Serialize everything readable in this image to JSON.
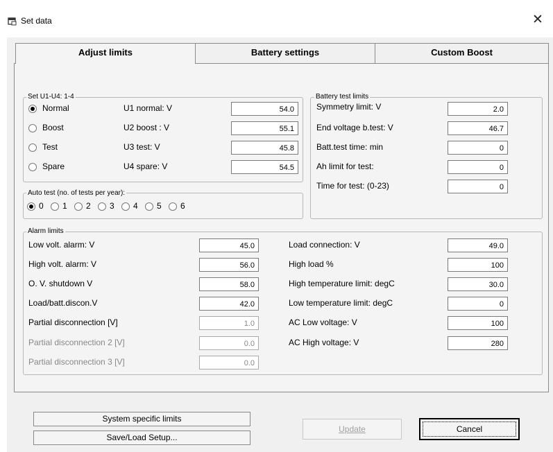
{
  "window": {
    "title": "Set data",
    "close_glyph": "✕"
  },
  "tabs": [
    "Adjust limits",
    "Battery settings",
    "Custom Boost"
  ],
  "set_u": {
    "legend": "Set U1-U4: 1-4",
    "rows": [
      {
        "radio": "Normal",
        "label": "U1 normal:  V",
        "value": "54.0",
        "checked": true
      },
      {
        "radio": "Boost",
        "label": "U2 boost :  V",
        "value": "55.1",
        "checked": false
      },
      {
        "radio": "Test",
        "label": "U3 test:   V",
        "value": "45.8",
        "checked": false
      },
      {
        "radio": "Spare",
        "label": "U4 spare:   V",
        "value": "54.5",
        "checked": false
      }
    ]
  },
  "auto_test": {
    "legend": "Auto test (no. of tests per year):",
    "options": [
      "0",
      "1",
      "2",
      "3",
      "4",
      "5",
      "6"
    ],
    "selected": "0"
  },
  "battery_test": {
    "legend": "Battery test limits",
    "rows": [
      {
        "label": "Symmetry limit: V",
        "value": "2.0"
      },
      {
        "label": "End voltage b.test: V",
        "value": "46.7"
      },
      {
        "label": "Batt.test time: min",
        "value": "0"
      },
      {
        "label": "Ah limit for test:",
        "value": "0"
      },
      {
        "label": "Time for test: (0-23)",
        "value": "0"
      }
    ]
  },
  "alarm_limits": {
    "legend": "Alarm limits",
    "left": [
      {
        "label": "Low volt. alarm: V",
        "value": "45.0",
        "disabled": false
      },
      {
        "label": "High volt. alarm: V",
        "value": "56.0",
        "disabled": false
      },
      {
        "label": "O. V. shutdown V",
        "value": "58.0",
        "disabled": false
      },
      {
        "label": "Load/batt.discon.V",
        "value": "42.0",
        "disabled": false
      },
      {
        "label": "Partial disconnection   [V]",
        "value": "1.0",
        "disabled": false
      },
      {
        "label": "Partial disconnection 2 [V]",
        "value": "0.0",
        "disabled": true
      },
      {
        "label": "Partial disconnection 3 [V]",
        "value": "0.0",
        "disabled": true
      }
    ],
    "right": [
      {
        "label": "Load connection: V",
        "value": "49.0"
      },
      {
        "label": "High load %",
        "value": "100"
      },
      {
        "label": "High temperature limit: degC",
        "value": "30.0"
      },
      {
        "label": "Low temperature limit: degC",
        "value": "0"
      },
      {
        "label": "AC Low voltage: V",
        "value": "100"
      },
      {
        "label": "AC High voltage: V",
        "value": "280"
      }
    ]
  },
  "buttons": {
    "system_limits": "System specific limits",
    "save_load": "Save/Load Setup...",
    "update": "Update",
    "cancel": "Cancel"
  },
  "icons": {
    "app": "window-icon",
    "close": "close-icon"
  }
}
